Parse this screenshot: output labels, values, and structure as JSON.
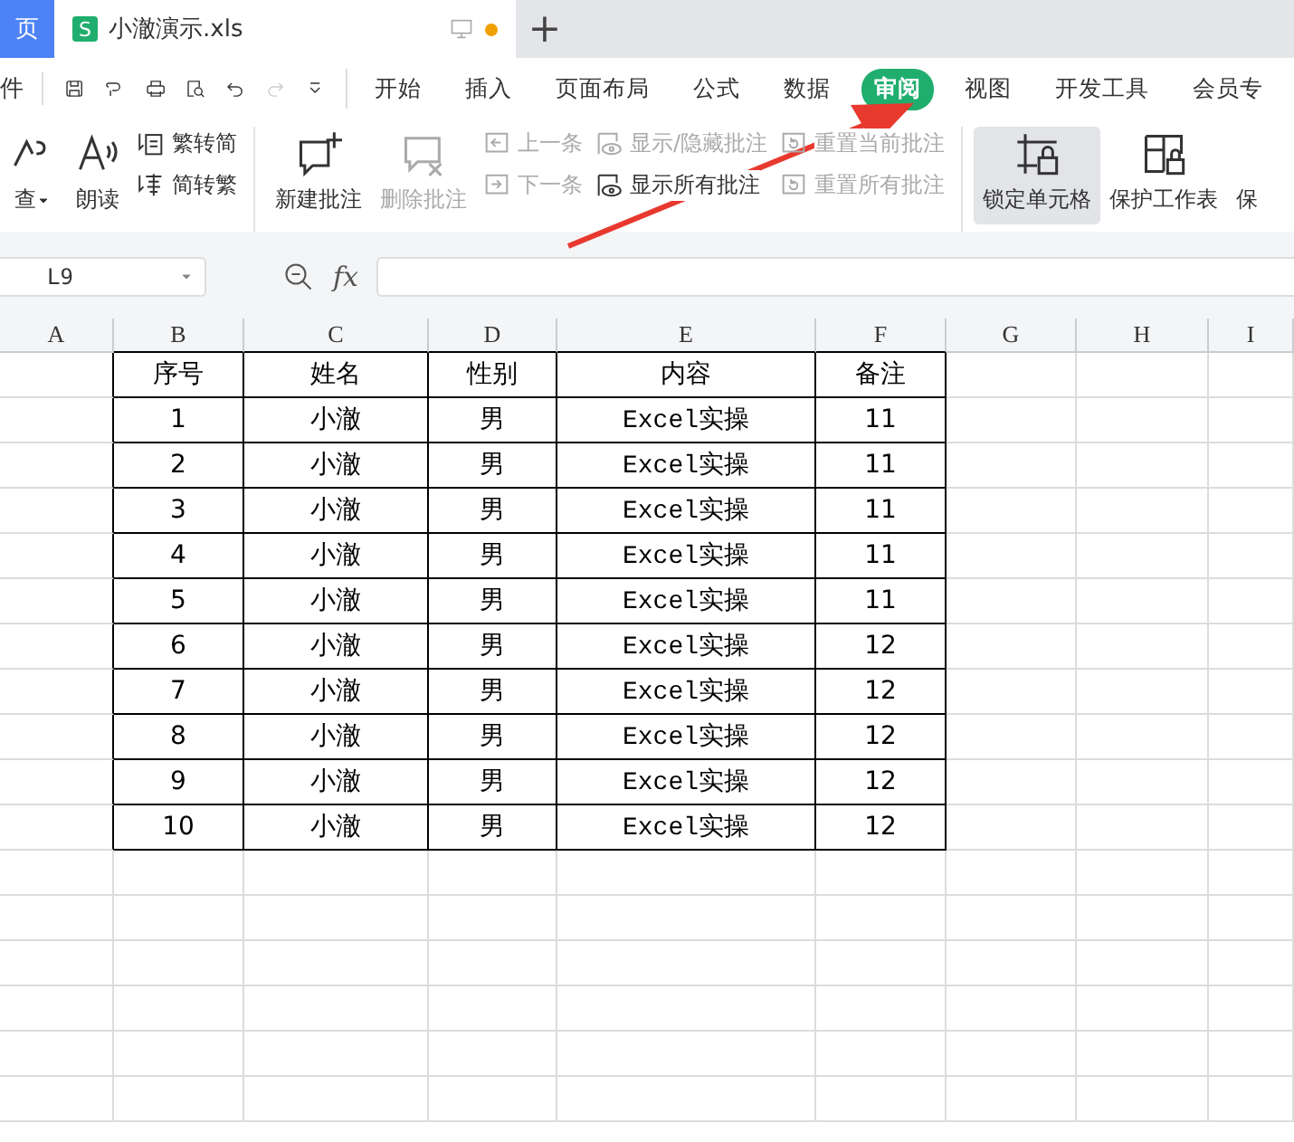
{
  "title_bar": {
    "home_tab": "页",
    "doc_tab": {
      "logo_letter": "S",
      "title": "小澈演示.xls",
      "modified": true,
      "selected": true
    },
    "new_tab": "+"
  },
  "quick_bar": {
    "file_menu": "件"
  },
  "menu_tabs": [
    {
      "label": "开始",
      "selected": false
    },
    {
      "label": "插入",
      "selected": false
    },
    {
      "label": "页面布局",
      "selected": false
    },
    {
      "label": "公式",
      "selected": false
    },
    {
      "label": "数据",
      "selected": false
    },
    {
      "label": "审阅",
      "selected": true
    },
    {
      "label": "视图",
      "selected": false
    },
    {
      "label": "开发工具",
      "selected": false
    },
    {
      "label": "会员专",
      "selected": false
    }
  ],
  "ribbon": [
    {
      "kind": "large",
      "label": "查",
      "dropdown": true,
      "disabled": false
    },
    {
      "kind": "large",
      "label": "朗读",
      "disabled": false
    },
    {
      "kind": "stack",
      "items": [
        {
          "label": "繁转简",
          "disabled": false
        },
        {
          "label": "简转繁",
          "disabled": false
        }
      ]
    },
    {
      "kind": "sep"
    },
    {
      "kind": "large",
      "label": "新建批注",
      "disabled": false
    },
    {
      "kind": "large",
      "label": "删除批注",
      "disabled": true
    },
    {
      "kind": "stack",
      "items": [
        {
          "label": "上一条",
          "disabled": true
        },
        {
          "label": "下一条",
          "disabled": true
        }
      ]
    },
    {
      "kind": "stack",
      "items": [
        {
          "label": "显示/隐藏批注",
          "disabled": true
        },
        {
          "label": "显示所有批注",
          "disabled": false
        }
      ]
    },
    {
      "kind": "stack",
      "items": [
        {
          "label": "重置当前批注",
          "disabled": true
        },
        {
          "label": "重置所有批注",
          "disabled": true
        }
      ]
    },
    {
      "kind": "sep"
    },
    {
      "kind": "large",
      "label": "锁定单元格",
      "disabled": false,
      "selected": true
    },
    {
      "kind": "large",
      "label": "保护工作表",
      "disabled": false,
      "selected": false
    },
    {
      "kind": "large",
      "label": "保",
      "disabled": false,
      "selected": false
    }
  ],
  "formula_bar": {
    "name_box": "L9",
    "fx": "fx"
  },
  "columns": [
    "A",
    "B",
    "C",
    "D",
    "E",
    "F",
    "G",
    "H",
    "I"
  ],
  "table": {
    "header": [
      "序号",
      "姓名",
      "性别",
      "内容",
      "备注"
    ],
    "rows": [
      [
        "1",
        "小澈",
        "男",
        "Excel实操",
        "11"
      ],
      [
        "2",
        "小澈",
        "男",
        "Excel实操",
        "11"
      ],
      [
        "3",
        "小澈",
        "男",
        "Excel实操",
        "11"
      ],
      [
        "4",
        "小澈",
        "男",
        "Excel实操",
        "11"
      ],
      [
        "5",
        "小澈",
        "男",
        "Excel实操",
        "11"
      ],
      [
        "6",
        "小澈",
        "男",
        "Excel实操",
        "12"
      ],
      [
        "7",
        "小澈",
        "男",
        "Excel实操",
        "12"
      ],
      [
        "8",
        "小澈",
        "男",
        "Excel实操",
        "12"
      ],
      [
        "9",
        "小澈",
        "男",
        "Excel实操",
        "12"
      ],
      [
        "10",
        "小澈",
        "男",
        "Excel实操",
        "12"
      ]
    ]
  }
}
